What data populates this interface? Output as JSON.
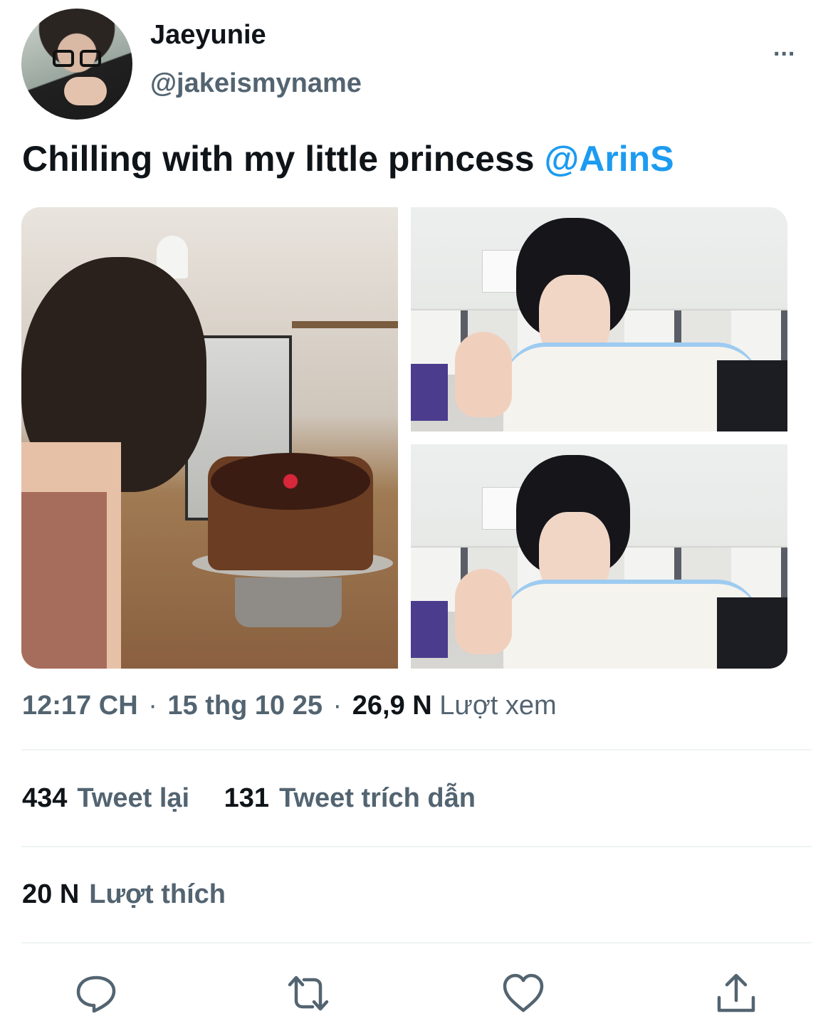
{
  "user": {
    "display_name": "Jaeyunie",
    "handle": "@jakeismyname",
    "more_label": "..."
  },
  "tweet": {
    "text": "Chilling with my little princess ",
    "mention": "@ArinS"
  },
  "media": {
    "photos": [
      "cake-photo",
      "boy-photo-peace-sign",
      "boy-photo-wave"
    ]
  },
  "meta": {
    "time": "12:17 CH",
    "date": "15 thg 10 25",
    "views_count": "26,9 N",
    "views_label": "Lượt xem",
    "separator": "·"
  },
  "stats": {
    "retweets_count": "434",
    "retweets_label": "Tweet lại",
    "quotes_count": "131",
    "quotes_label": "Tweet trích dẫn",
    "likes_count": "20 N",
    "likes_label": "Lượt thích"
  },
  "actions": {
    "icons": [
      "reply-icon",
      "retweet-icon",
      "like-icon",
      "share-icon"
    ]
  },
  "colors": {
    "text": "#0f1419",
    "secondary": "#536471",
    "mention": "#1d9bf0",
    "divider": "#eff3f4"
  }
}
